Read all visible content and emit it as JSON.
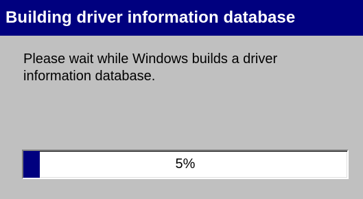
{
  "dialog": {
    "title": "Building driver information database",
    "message": "Please wait while Windows builds a driver information database.",
    "progress": {
      "percent_label": "5%",
      "value_fraction": 0.05
    }
  },
  "colors": {
    "title_bar": "#00007f",
    "title_text": "#ffffff",
    "dialog_background": "#c0c0c0",
    "progress_fill": "#00007f",
    "progress_track": "#ffffff"
  }
}
